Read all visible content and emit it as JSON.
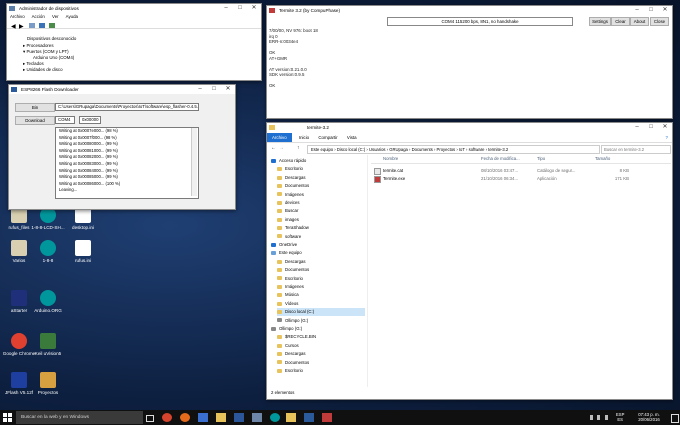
{
  "desktop_icons": [
    {
      "label": "rufus_files"
    },
    {
      "label": "1-8-8-LCD-SH..."
    },
    {
      "label": "desktop.ini"
    },
    {
      "label": "Varios"
    },
    {
      "label": "1-8-8"
    },
    {
      "label": "rufus.ini"
    },
    {
      "label": "aStarter"
    },
    {
      "label": "Arduino.ORG"
    },
    {
      "label": "Google Chrome"
    },
    {
      "label": "Keil uVision5"
    },
    {
      "label": "JFlash V5.12f"
    },
    {
      "label": "Proyectos"
    }
  ],
  "device_manager": {
    "title": "Administrador de dispositivos",
    "menu": [
      "Archivo",
      "Acción",
      "Ver",
      "Ayuda"
    ],
    "tree": [
      "Dispositivos desconocido",
      "Procesadores",
      "Puertos (COM y LPT)",
      "Arduino Uno (COM4)",
      "Teclados",
      "Unidades de disco"
    ]
  },
  "flasher": {
    "title": "ESP8266 Flash Downloader",
    "bin_label": "Bin",
    "bin_path": "C:\\Users\\GRupaga\\Documents\\Proyectos\\IoT\\software\\esp_flasher-0.4.5.3.bin",
    "download_label": "Download",
    "com": "COM4",
    "addr": "0x00000",
    "log": [
      "Writing at 0x0007e000... (98 %)",
      "Writing at 0x0007f000... (98 %)",
      "Writing at 0x00080000... (99 %)",
      "Writing at 0x00081000... (99 %)",
      "Writing at 0x00082000... (99 %)",
      "Writing at 0x00083000... (99 %)",
      "Writing at 0x00084000... (99 %)",
      "Writing at 0x00085000... (99 %)",
      "Writing at 0x00086000... (100 %)",
      "Leaving..."
    ]
  },
  "termite": {
    "title": "Termite 3.2 (by CompuPhase)",
    "port_status": "COM4 115200 bps, 8N1, no handshake",
    "buttons": [
      "Settings",
      "Clear",
      "About",
      "Close"
    ],
    "lines": [
      "7/00/00, NV 976: boot 18",
      "irq 0",
      "ERR-n:0034e4",
      "",
      "OK",
      "AT+GMR",
      "",
      "AT version:0.21.0.0",
      "SDK version:0.9.5",
      "",
      "OK"
    ]
  },
  "explorer": {
    "title": "termite-3.2",
    "ribbon_tabs": [
      "Archivo",
      "Inicio",
      "Compartir",
      "Vista"
    ],
    "breadcrumb": [
      "Este equipo",
      "Disco local (C:)",
      "Usuarios",
      "GRUpaga",
      "Documents",
      "Proyectos",
      "IoT",
      "software",
      "termite-3.2"
    ],
    "search_placeholder": "Buscar en termite-3.2",
    "columns": [
      "Nombre",
      "Fecha de modifica...",
      "Tipo",
      "Tamaño"
    ],
    "files": [
      {
        "name": "termite.cat",
        "date": "08/10/2016 03:47...",
        "type": "Catálogo de segur...",
        "size": "8 KB"
      },
      {
        "name": "Termite.exe",
        "date": "21/10/2016 06:34...",
        "type": "Aplicación",
        "size": "171 KB"
      }
    ],
    "nav": [
      "Acceso rápido",
      "Escritorio",
      "Descargas",
      "Documentos",
      "Imágenes",
      "devices",
      "Buscar",
      "images",
      "TeraShadow",
      "software",
      "OneDrive",
      "Este equipo",
      "Descargas",
      "Documentos",
      "Escritorio",
      "Imágenes",
      "Música",
      "Vídeos",
      "Disco local (C:)",
      "Ollimpo (G:)",
      "Ollimpo (G:)",
      "$RECYCLE.BIN",
      "Cursos",
      "Descargas",
      "Documentos",
      "Escritorio"
    ],
    "status": "2 elementos"
  },
  "taskbar": {
    "search_placeholder": "Buscar en la web y en Windows",
    "lang_top": "ESP",
    "lang_bottom": "ES",
    "time": "07:43 p. m.",
    "date": "20/06/2016"
  },
  "colors": {
    "taskbar": "#101010",
    "accent": "#1f6fd0",
    "selection": "#cce4f7"
  }
}
